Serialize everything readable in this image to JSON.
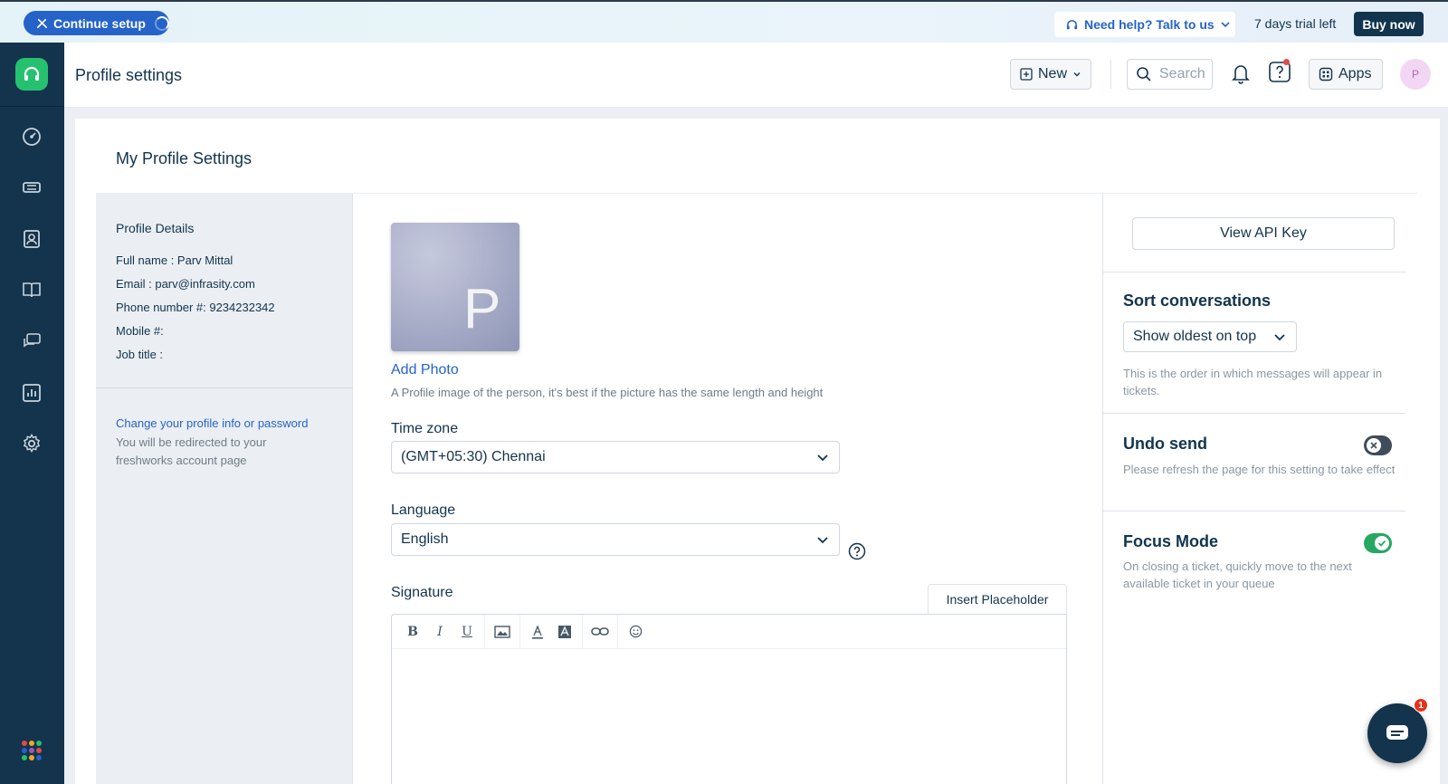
{
  "topbar": {
    "continue_label": "Continue setup",
    "help_label": "Need help? Talk to us",
    "trial_text": "7 days trial left",
    "buy_label": "Buy now"
  },
  "header": {
    "title": "Profile settings",
    "new_label": "New",
    "search_placeholder": "Search",
    "apps_label": "Apps",
    "avatar_initial": "P"
  },
  "sidebar": {
    "items": [
      "dashboard-icon",
      "tickets-icon",
      "contacts-icon",
      "solutions-icon",
      "forums-icon",
      "reports-icon",
      "admin-settings-icon"
    ],
    "app_dot_colors": [
      "#e5484d",
      "#f5a623",
      "#25c16f",
      "#2563c9",
      "#9b59b6",
      "#e5484d",
      "#25c16f",
      "#f5a623",
      "#2563c9"
    ]
  },
  "main": {
    "section_title": "My Profile Settings",
    "profile": {
      "title": "Profile Details",
      "full_name": "Full name : Parv Mittal",
      "email": "Email : parv@infrasity.com",
      "phone": "Phone number #: 9234232342",
      "mobile": "Mobile #:",
      "job_title": "Job title :",
      "change_link": "Change your profile info or password",
      "change_note": "You will be redirected to your freshworks account page"
    },
    "photo": {
      "initial": "P",
      "add_label": "Add Photo",
      "help": "A Profile image of the person, it's best if the picture has the same length and height"
    },
    "timezone": {
      "label": "Time zone",
      "value": "(GMT+05:30) Chennai"
    },
    "language": {
      "label": "Language",
      "value": "English"
    },
    "signature": {
      "label": "Signature",
      "insert_label": "Insert Placeholder"
    }
  },
  "right": {
    "api_label": "View API Key",
    "sort": {
      "title": "Sort conversations",
      "value": "Show oldest on top",
      "desc": "This is the order in which messages will appear in tickets."
    },
    "undo": {
      "title": "Undo send",
      "desc": "Please refresh the page for this setting to take effect",
      "enabled": false
    },
    "focus": {
      "title": "Focus Mode",
      "desc": "On closing a ticket, quickly move to the next available ticket in your queue",
      "enabled": true
    }
  },
  "chat": {
    "badge_count": "1"
  },
  "colors": {
    "sidebar": "#13344c",
    "accent": "#2563c9",
    "brand_green": "#25c16f"
  }
}
